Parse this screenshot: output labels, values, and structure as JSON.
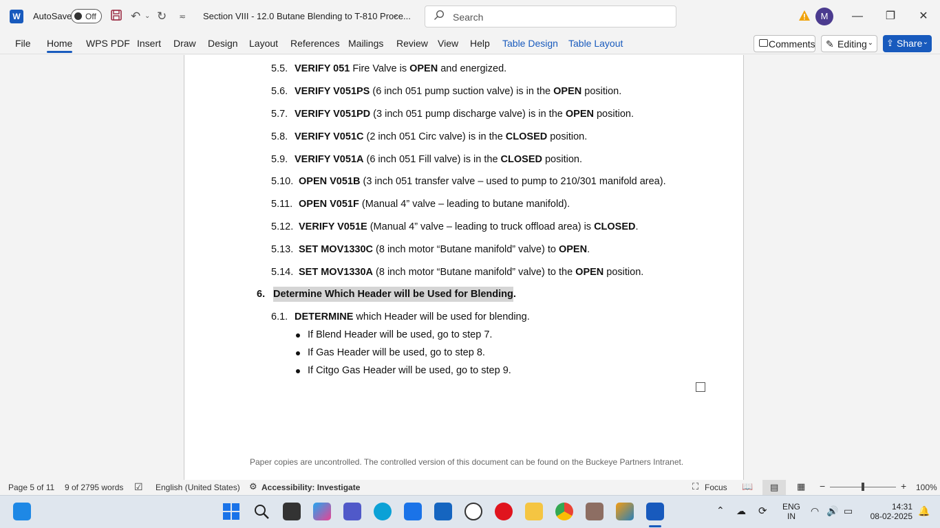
{
  "titlebar": {
    "autosave_label": "AutoSave",
    "autosave_state": "Off",
    "document_title": "Section VIII - 12.0 Butane Blending to T-810 Proce...",
    "search_placeholder": "Search",
    "avatar_initial": "M",
    "icons": [
      "word-app-icon",
      "save-icon",
      "undo-icon",
      "redo-icon",
      "customize-toolbar-icon",
      "warning-icon",
      "minimize-icon",
      "restore-icon",
      "close-icon"
    ]
  },
  "ribbon": {
    "tabs": [
      "File",
      "Home",
      "WPS PDF",
      "Insert",
      "Draw",
      "Design",
      "Layout",
      "References",
      "Mailings",
      "Review",
      "View",
      "Help",
      "Table Design",
      "Table Layout"
    ],
    "active_tab": "Home",
    "comments_label": "Comments",
    "editing_label": "Editing",
    "share_label": "Share",
    "accent_color": "#185abd"
  },
  "document": {
    "steps": [
      {
        "num": "5.5.",
        "parts": [
          {
            "t": "VERIFY 051",
            "b": true
          },
          {
            "t": " Fire Valve is ",
            "b": false
          },
          {
            "t": "OPEN",
            "b": true
          },
          {
            "t": " and energized.",
            "b": false
          }
        ]
      },
      {
        "num": "5.6.",
        "parts": [
          {
            "t": "VERIFY V051PS",
            "b": true
          },
          {
            "t": " (6 inch 051 pump suction valve) is in the ",
            "b": false
          },
          {
            "t": "OPEN",
            "b": true
          },
          {
            "t": " position.",
            "b": false
          }
        ]
      },
      {
        "num": "5.7.",
        "parts": [
          {
            "t": "VERIFY V051PD",
            "b": true
          },
          {
            "t": " (3 inch 051 pump discharge valve) is in the ",
            "b": false
          },
          {
            "t": "OPEN",
            "b": true
          },
          {
            "t": " position.",
            "b": false
          }
        ]
      },
      {
        "num": "5.8.",
        "parts": [
          {
            "t": "VERIFY V051C",
            "b": true
          },
          {
            "t": " (2 inch 051 Circ valve) is in the ",
            "b": false
          },
          {
            "t": "CLOSED",
            "b": true
          },
          {
            "t": " position.",
            "b": false
          }
        ]
      },
      {
        "num": "5.9.",
        "parts": [
          {
            "t": "VERIFY V051A",
            "b": true
          },
          {
            "t": " (6 inch 051 Fill valve) is in the ",
            "b": false
          },
          {
            "t": "CLOSED",
            "b": true
          },
          {
            "t": " position.",
            "b": false
          }
        ]
      },
      {
        "num": "5.10.",
        "parts": [
          {
            "t": "OPEN V051B",
            "b": true
          },
          {
            "t": " (3 inch 051 transfer valve – used to pump to 210/301 manifold area).",
            "b": false
          }
        ]
      },
      {
        "num": "5.11.",
        "parts": [
          {
            "t": "OPEN V051F",
            "b": true
          },
          {
            "t": " (Manual 4” valve – leading to butane manifold).",
            "b": false
          }
        ]
      },
      {
        "num": "5.12.",
        "parts": [
          {
            "t": "VERIFY V051E",
            "b": true
          },
          {
            "t": " (Manual 4” valve – leading to truck offload area) is ",
            "b": false
          },
          {
            "t": "CLOSED",
            "b": true
          },
          {
            "t": ".",
            "b": false
          }
        ]
      },
      {
        "num": "5.13.",
        "parts": [
          {
            "t": "SET MOV1330C",
            "b": true
          },
          {
            "t": " (8 inch motor “Butane manifold” valve) to ",
            "b": false
          },
          {
            "t": "OPEN",
            "b": true
          },
          {
            "t": ".",
            "b": false
          }
        ]
      },
      {
        "num": "5.14.",
        "parts": [
          {
            "t": "SET MOV1330A",
            "b": true
          },
          {
            "t": " (8 inch motor “Butane manifold” valve) to the ",
            "b": false
          },
          {
            "t": "OPEN",
            "b": true
          },
          {
            "t": " position.",
            "b": false
          }
        ]
      }
    ],
    "section": {
      "num": "6.",
      "title": "Determine Which Header will be Used for Blending",
      "trailing": "."
    },
    "substep": {
      "num": "6.1.",
      "parts": [
        {
          "t": "DETERMINE",
          "b": true
        },
        {
          "t": " which Header will be used for blending.",
          "b": false
        }
      ]
    },
    "bullets": [
      "If Blend Header will be used, go to step 7.",
      "If Gas Header will be used, go to step 8.",
      "If Citgo Gas Header will be used, go to step 9."
    ],
    "footer_note": "Paper copies are uncontrolled. The controlled version of this document can be found on the Buckeye Partners Intranet."
  },
  "statusbar": {
    "page": "Page 5 of 11",
    "words": "9 of 2795 words",
    "language": "English (United States)",
    "accessibility": "Accessibility: Investigate",
    "focus": "Focus",
    "zoom": "100%",
    "zoom_level": 1.0
  },
  "taskbar": {
    "language": "ENG",
    "region": "IN",
    "time": "14:31",
    "date": "08-02-2025",
    "apps": [
      "widgets-icon",
      "start-icon",
      "search-icon",
      "task-view-icon",
      "copilot-icon",
      "teams-icon",
      "edge-icon",
      "store-icon",
      "powerautomate-icon",
      "dell-icon",
      "opera-icon",
      "file-explorer-icon",
      "chrome-icon",
      "remote-app-icon",
      "photos-icon",
      "word-icon"
    ]
  }
}
